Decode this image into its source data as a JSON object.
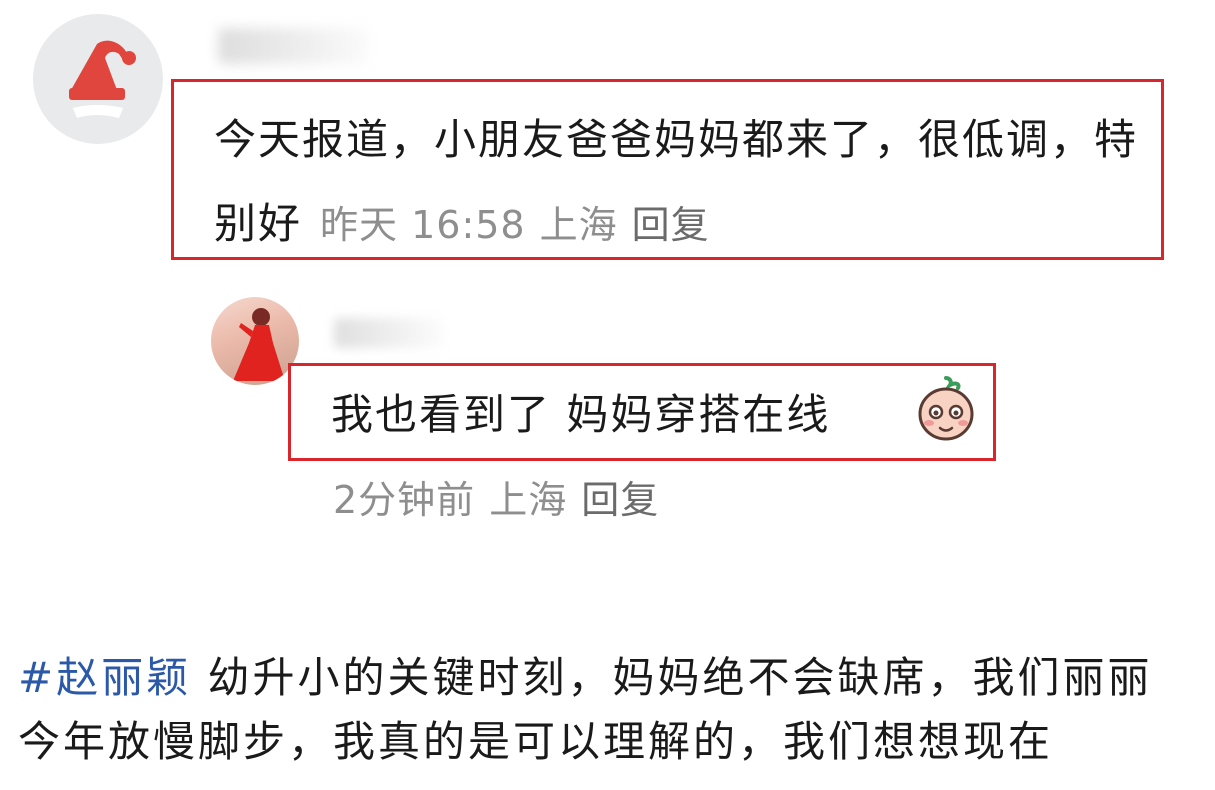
{
  "comment": {
    "text": "今天报道，小朋友爸爸妈妈都来了，很低调，特别好",
    "time": "昨天 16:58",
    "location": "上海",
    "reply_label": "回复"
  },
  "reply": {
    "text": "我也看到了 妈妈穿搭在线",
    "emoji_icon": "shy-face-emoji",
    "time": "2分钟前",
    "location": "上海",
    "reply_label": "回复"
  },
  "post": {
    "hashtag": "#赵丽颖",
    "text": " 幼升小的关键时刻，妈妈绝不会缺席，我们丽丽今年放慢脚步，我真的是可以理解的，我们想想现在"
  },
  "colors": {
    "highlight_border": "#d8262c",
    "hashtag": "#2b59a8",
    "meta_text": "#8e8e8e"
  }
}
